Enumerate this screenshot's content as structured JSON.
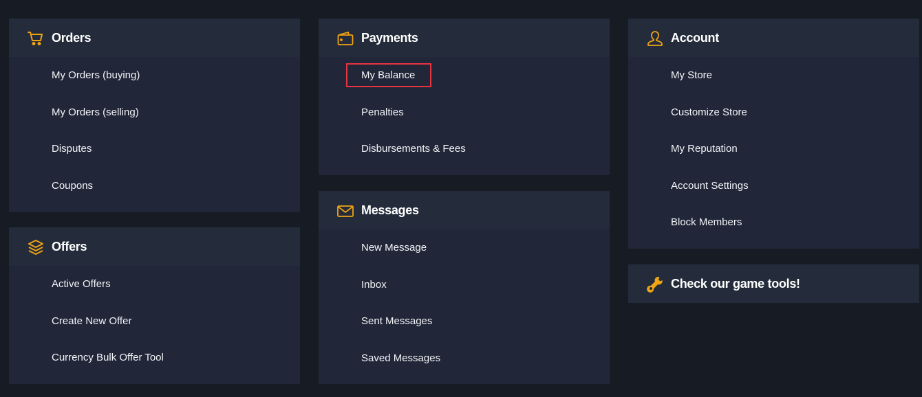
{
  "accent_color": "#f0a313",
  "highlight_color": "#e8343f",
  "cards": {
    "orders": {
      "title": "Orders",
      "icon": "cart-icon",
      "items": [
        "My Orders (buying)",
        "My Orders (selling)",
        "Disputes",
        "Coupons"
      ]
    },
    "offers": {
      "title": "Offers",
      "icon": "layers-icon",
      "items": [
        "Active Offers",
        "Create New Offer",
        "Currency Bulk Offer Tool"
      ]
    },
    "payments": {
      "title": "Payments",
      "icon": "wallet-icon",
      "items": [
        "My Balance",
        "Penalties",
        "Disbursements & Fees"
      ],
      "highlighted_item": "My Balance"
    },
    "messages": {
      "title": "Messages",
      "icon": "envelope-icon",
      "items": [
        "New Message",
        "Inbox",
        "Sent Messages",
        "Saved Messages"
      ]
    },
    "account": {
      "title": "Account",
      "icon": "user-icon",
      "items": [
        "My Store",
        "Customize Store",
        "My Reputation",
        "Account Settings",
        "Block Members"
      ]
    },
    "tools": {
      "title": "Check our game tools!",
      "icon": "wrench-icon"
    }
  }
}
